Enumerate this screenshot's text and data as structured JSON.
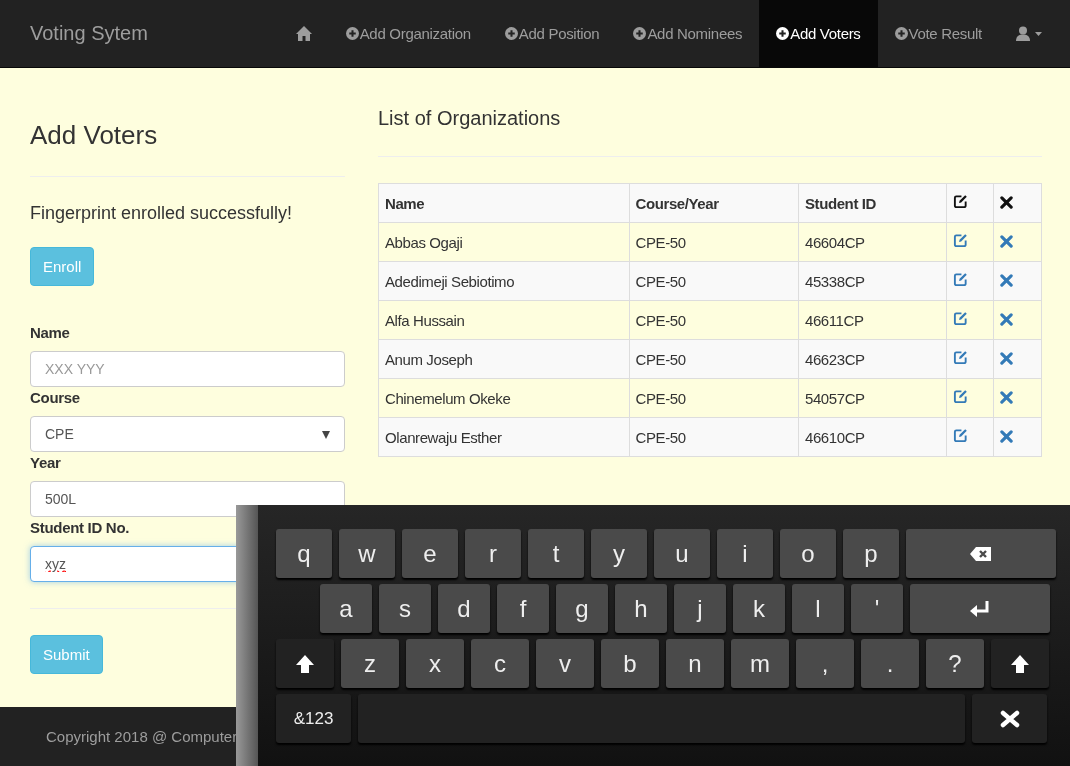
{
  "navbar": {
    "brand": "Voting Sytem",
    "items": [
      {
        "kind": "home",
        "selected": false
      },
      {
        "kind": "link",
        "label": "Add Organization",
        "selected": false
      },
      {
        "kind": "link",
        "label": "Add Position",
        "selected": false
      },
      {
        "kind": "link",
        "label": "Add Nominees",
        "selected": false
      },
      {
        "kind": "link",
        "label": "Add Voters",
        "selected": true
      },
      {
        "kind": "link",
        "label": "Vote Result",
        "selected": false
      },
      {
        "kind": "user",
        "selected": false
      }
    ]
  },
  "form": {
    "title": "Add Voters",
    "message": "Fingerprint enrolled successfully!",
    "enroll_button": "Enroll",
    "fields": [
      {
        "kind": "text",
        "label": "Name",
        "placeholder": "XXX YYY"
      },
      {
        "kind": "select",
        "label": "Course",
        "value": "CPE"
      },
      {
        "kind": "text",
        "label": "Year",
        "value": "500L"
      },
      {
        "kind": "text",
        "label": "Student ID No.",
        "value": "xyz",
        "focused": true
      }
    ],
    "submit_button": "Submit"
  },
  "table": {
    "title": "List of Organizations",
    "columns": [
      "Name",
      "Course/Year",
      "Student ID"
    ],
    "rows": [
      [
        "Abbas Ogaji",
        "CPE-50",
        "46604CP"
      ],
      [
        "Adedimeji Sebiotimo",
        "CPE-50",
        "45338CP"
      ],
      [
        "Alfa Hussain",
        "CPE-50",
        "46611CP"
      ],
      [
        "Anum Joseph",
        "CPE-50",
        "46623CP"
      ],
      [
        "Chinemelum Okeke",
        "CPE-50",
        "54057CP"
      ],
      [
        "Olanrewaju Esther",
        "CPE-50",
        "46610CP"
      ]
    ]
  },
  "footer": {
    "text": "Copyright 2018 @ Computer"
  },
  "keyboard": {
    "rows": [
      [
        {
          "kind": "char",
          "label": "q"
        },
        {
          "kind": "char",
          "label": "w"
        },
        {
          "kind": "char",
          "label": "e"
        },
        {
          "kind": "char",
          "label": "r"
        },
        {
          "kind": "char",
          "label": "t"
        },
        {
          "kind": "char",
          "label": "y"
        },
        {
          "kind": "char",
          "label": "u"
        },
        {
          "kind": "char",
          "label": "i"
        },
        {
          "kind": "char",
          "label": "o"
        },
        {
          "kind": "char",
          "label": "p"
        },
        {
          "kind": "backspace"
        }
      ],
      [
        {
          "kind": "char",
          "label": "a"
        },
        {
          "kind": "char",
          "label": "s"
        },
        {
          "kind": "char",
          "label": "d"
        },
        {
          "kind": "char",
          "label": "f"
        },
        {
          "kind": "char",
          "label": "g"
        },
        {
          "kind": "char",
          "label": "h"
        },
        {
          "kind": "char",
          "label": "j"
        },
        {
          "kind": "char",
          "label": "k"
        },
        {
          "kind": "char",
          "label": "l"
        },
        {
          "kind": "char",
          "label": "'"
        },
        {
          "kind": "enter"
        }
      ],
      [
        {
          "kind": "shift"
        },
        {
          "kind": "char",
          "label": "z"
        },
        {
          "kind": "char",
          "label": "x"
        },
        {
          "kind": "char",
          "label": "c"
        },
        {
          "kind": "char",
          "label": "v"
        },
        {
          "kind": "char",
          "label": "b"
        },
        {
          "kind": "char",
          "label": "n"
        },
        {
          "kind": "char",
          "label": "m"
        },
        {
          "kind": "char",
          "label": ","
        },
        {
          "kind": "char",
          "label": "."
        },
        {
          "kind": "char",
          "label": "?"
        },
        {
          "kind": "shift"
        }
      ],
      [
        {
          "kind": "mode",
          "label": "&123"
        },
        {
          "kind": "space"
        },
        {
          "kind": "close"
        }
      ]
    ]
  }
}
